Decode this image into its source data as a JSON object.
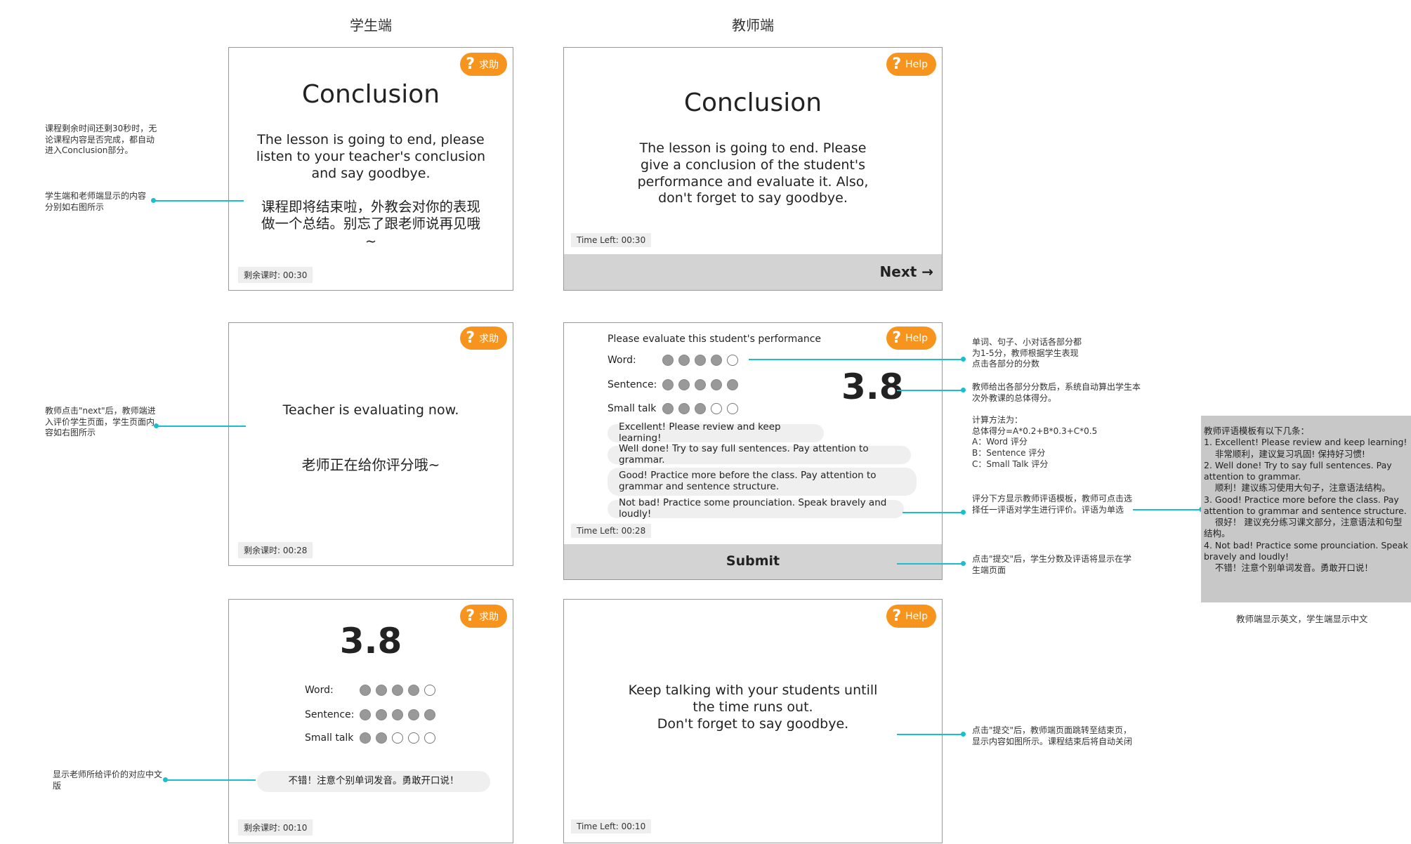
{
  "headers": {
    "student": "学生端",
    "teacher": "教师端"
  },
  "help": {
    "cn": "求助",
    "en": "Help"
  },
  "panel1": {
    "title": "Conclusion",
    "text_en": "The lesson is going to end, please listen to your teacher's conclusion and say goodbye.",
    "text_cn": "课程即将结束啦，外教会对你的表现做一个总结。别忘了跟老师说再见哦~",
    "timer": "剩余课时: 00:30"
  },
  "panel2": {
    "title": "Conclusion",
    "text": "The lesson is going to end. Please give a conclusion of the student's performance and evaluate it. Also, don't forget to say goodbye.",
    "timer": "Time Left: 00:30",
    "next": "Next →"
  },
  "panel3": {
    "text_en": "Teacher is evaluating now.",
    "text_cn": "老师正在给你评分哦~",
    "timer": "剩余课时: 00:28"
  },
  "panel4": {
    "prompt": "Please evaluate this student's performance",
    "word_label": "Word:",
    "sentence_label": "Sentence:",
    "smalltalk_label": "Small talk",
    "ratings": {
      "word": 4,
      "sentence": 5,
      "smalltalk": 3,
      "max": 5
    },
    "score": "3.8",
    "comments": [
      "Excellent! Please review and keep learning!",
      "Well done! Try to say full sentences. Pay attention to grammar.",
      "Good! Practice more before the class. Pay attention to grammar and sentence structure.",
      "Not bad! Practice some prounciation. Speak bravely and loudly!"
    ],
    "timer": "Time Left: 00:28",
    "submit": "Submit"
  },
  "panel5": {
    "score": "3.8",
    "word_label": "Word:",
    "sentence_label": "Sentence:",
    "smalltalk_label": "Small talk",
    "ratings": {
      "word": 4,
      "sentence": 5,
      "smalltalk": 2,
      "max": 5
    },
    "comment": "不错！注意个别单词发音。勇敢开口说！",
    "timer": "剩余课时: 00:10"
  },
  "panel6": {
    "line1": "Keep talking with your students untill",
    "line2": "the time runs out.",
    "line3": "Don't forget to say goodbye.",
    "timer": "Time Left: 00:10"
  },
  "notes": {
    "n1": "课程剩余时间还剩30秒时，无论课程内容是否完成，都自动进入Conclusion部分。",
    "n2": "学生端和老师端显示的内容分别如右图所示",
    "n3": "教师点击\"next\"后，教师端进入评价学生页面，学生页面内容如右图所示",
    "n4": "显示老师所给评价的对应中文版",
    "r1": "单词、句子、小对话各部分都为1-5分，教师根据学生表现点击各部分的分数",
    "r2": "教师给出各部分分数后，系统自动算出学生本次外教课的总体得分。",
    "r2_formula_title": "计算方法为：",
    "r2_formula": "总体得分=A*0.2+B*0.3+C*0.5",
    "r2_a": "A：Word 评分",
    "r2_b": "B：Sentence 评分",
    "r2_c": "C：Small Talk 评分",
    "r3": "评分下方显示教师评语模板，教师可点击选择任一评语对学生进行评价。评语为单选",
    "r4": "点击\"提交\"后，学生分数及评语将显示在学生端页面",
    "r5": "点击\"提交\"后，教师端页面跳转至结束页，显示内容如图所示。课程结束后将自动关闭"
  },
  "sidebox": {
    "lines": [
      "教师评语模板有以下几条：",
      "1. Excellent! Please review and keep learning!",
      "    非常顺利，建议复习巩固! 保持好习惯!",
      "2. Well done! Try to say full sentences. Pay attention to grammar.",
      "    顺利！建议练习使用大句子，注意语法结构。",
      "3. Good! Practice more before the class. Pay attention to grammar and sentence structure.",
      "    很好！ 建议充分练习课文部分，注意语法和句型结构。",
      "4. Not bad! Practice some prounciation. Speak bravely and loudly!",
      "    不错！注意个别单词发音。勇敢开口说！"
    ],
    "caption": "教师端显示英文，学生端显示中文"
  },
  "colors": {
    "accent": "#f7941d",
    "connector": "#19bfcc",
    "bar": "#d3d3d3"
  }
}
